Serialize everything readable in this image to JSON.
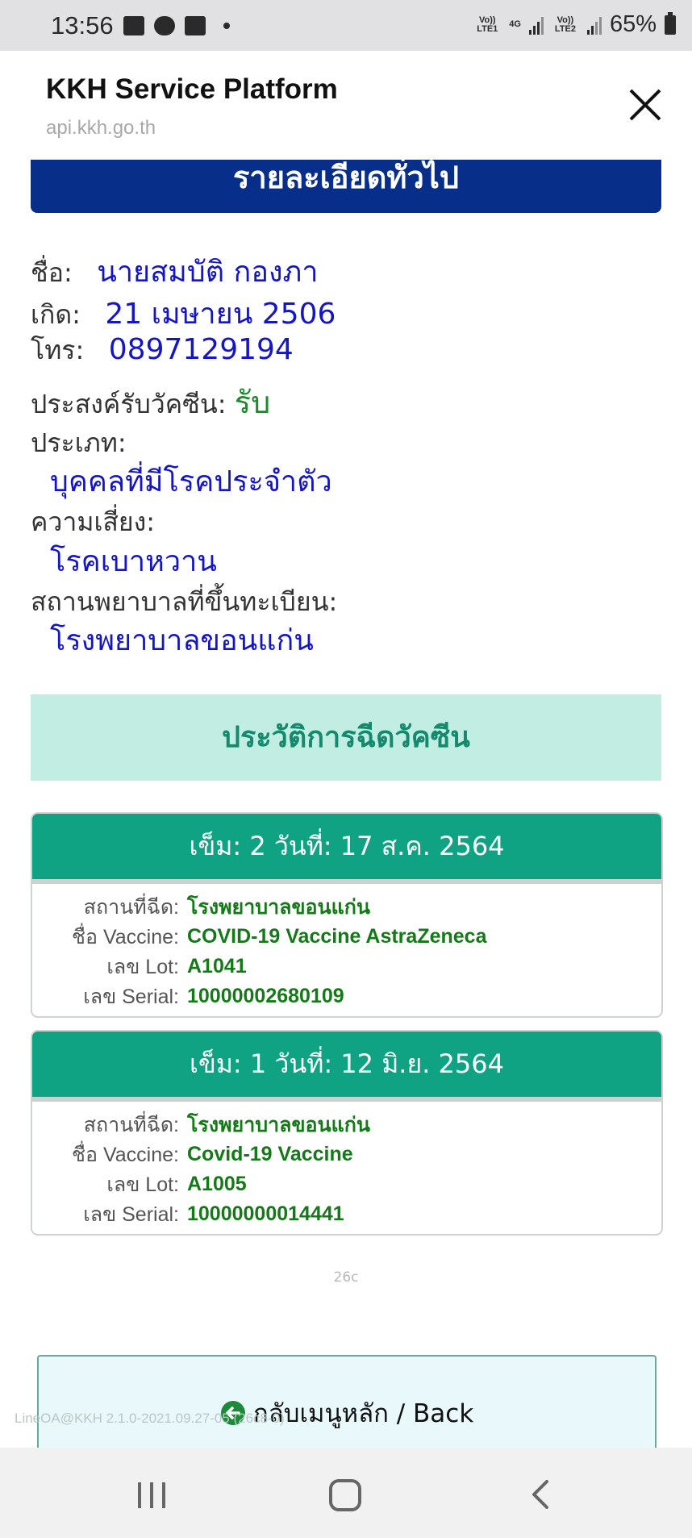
{
  "status_bar": {
    "time": "13:56",
    "network1": "Vo)) LTE1",
    "network_type": "4G",
    "network2": "Vo)) LTE2",
    "battery": "65%"
  },
  "browser": {
    "title": "KKH Service Platform",
    "url": "api.kkh.go.th"
  },
  "general": {
    "header": "รายละเอียดทั่วไป",
    "name_label": "ชื่อ:",
    "name_value": "นายสมบัติ กองภา",
    "birth_label": "เกิด:",
    "birth_value": "21 เมษายน 2506",
    "phone_label": "โทร:",
    "phone_value": "0897129194",
    "intent_label": "ประสงค์รับวัคซีน:",
    "intent_value": "รับ",
    "type_label": "ประเภท:",
    "type_value": "บุคคลที่มีโรคประจำตัว",
    "risk_label": "ความเสี่ยง:",
    "risk_value": "โรคเบาหวาน",
    "hospital_label": "สถานพยาบาลที่ขึ้นทะเบียน:",
    "hospital_value": "โรงพยาบาลขอนแก่น"
  },
  "history": {
    "header": "ประวัติการฉีดวัคซีน",
    "labels": {
      "place": "สถานที่ฉีด:",
      "vaccine": "ชื่อ Vaccine:",
      "lot": "เลข Lot:",
      "serial": "เลข Serial:"
    },
    "doses": [
      {
        "title": "เข็ม: 2 วันที่: 17 ส.ค. 2564",
        "place": "โรงพยาบาลขอนแก่น",
        "vaccine": "COVID-19 Vaccine AstraZeneca",
        "lot": "A1041",
        "serial": "10000002680109"
      },
      {
        "title": "เข็ม: 1 วันที่: 12 มิ.ย. 2564",
        "place": "โรงพยาบาลขอนแก่น",
        "vaccine": "Covid-19 Vaccine",
        "lot": "A1005",
        "serial": "10000000014441"
      }
    ]
  },
  "version_code": "26c",
  "back_button": "กลับเมนูหลัก / Back",
  "footer_version": "LineOA@KKH 2.1.0-2021.09.27-05 (26c8-0)",
  "colors": {
    "navy": "#072f8a",
    "teal": "#0fa383",
    "mint": "#c2ede2",
    "value_blue": "#1414c8",
    "value_green": "#137a17"
  }
}
